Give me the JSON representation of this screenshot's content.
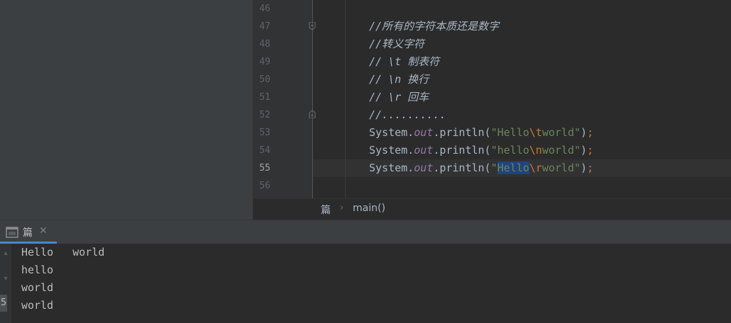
{
  "editor": {
    "line_numbers": [
      "46",
      "47",
      "48",
      "49",
      "50",
      "51",
      "52",
      "53",
      "54",
      "55",
      "56"
    ],
    "comments": {
      "c47": "//所有的字符本质还是数字",
      "c48": "//转义字符",
      "c49": "// \\t 制表符",
      "c50": "// \\n 换行",
      "c51": "// \\r 回车",
      "c52": "//.........."
    },
    "code": {
      "system": "System.",
      "out": "out",
      "println": ".println(",
      "quote": "\"",
      "hello_cap": "Hello",
      "hello_low": "hello",
      "esc_t": "\\t",
      "esc_n": "\\n",
      "esc_r": "\\r",
      "world": "world",
      "close": ")",
      "semi": ";"
    }
  },
  "breadcrumb": {
    "class_name": "篇",
    "separator": "›",
    "method_name": "main()"
  },
  "run_panel": {
    "tab_label": "篇",
    "close_glyph": "✕",
    "output": [
      "Hello   world",
      "hello",
      "world",
      "world"
    ],
    "rerun_glyph": "5"
  },
  "colors": {
    "editor_bg": "#2b2b2b",
    "gutter_bg": "#313335",
    "panel_bg": "#3c3f41",
    "string": "#6a8759",
    "escape": "#cc7832",
    "field": "#9876aa",
    "selection": "#214283",
    "tab_underline": "#4a88c7"
  },
  "icons": {
    "run_tab": "console-icon",
    "fold": "fold-marker-icon"
  }
}
